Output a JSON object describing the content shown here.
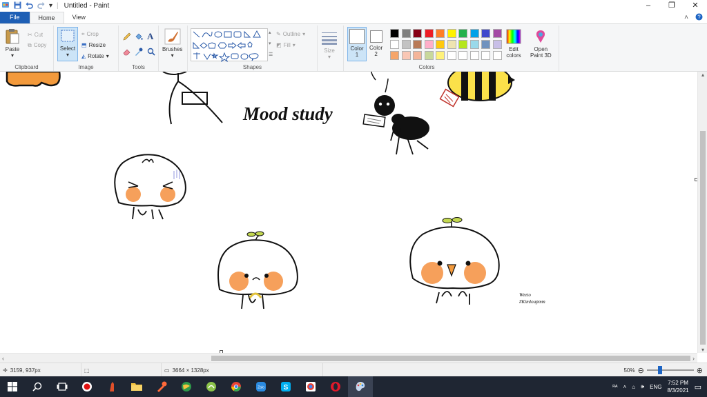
{
  "window": {
    "title": "Untitled - Paint"
  },
  "tabs": [
    {
      "label": "File"
    },
    {
      "label": "Home"
    },
    {
      "label": "View"
    }
  ],
  "ribbon": {
    "clipboard": {
      "label": "Clipboard",
      "paste": "Paste",
      "cut": "Cut",
      "copy": "Copy"
    },
    "image": {
      "label": "Image",
      "select": "Select",
      "crop": "Crop",
      "resize": "Resize",
      "rotate": "Rotate"
    },
    "tools": {
      "label": "Tools"
    },
    "brushes": {
      "label": "Brushes"
    },
    "shapes": {
      "label": "Shapes",
      "outline": "Outline",
      "fill": "Fill"
    },
    "size": {
      "label": "Size"
    },
    "colors": {
      "label": "Colors",
      "color1": "Color",
      "color1_num": "1",
      "color2": "Color",
      "color2_num": "2",
      "edit_colors_1": "Edit",
      "edit_colors_2": "colors",
      "paint3d_1": "Open",
      "paint3d_2": "Paint 3D",
      "palette_row1": [
        "#000000",
        "#7f7f7f",
        "#880015",
        "#ed1c24",
        "#ff7f27",
        "#fff200",
        "#22b14c",
        "#00a2e8",
        "#3f48cc",
        "#a349a4"
      ],
      "palette_row2": [
        "#ffffff",
        "#c3c3c3",
        "#b97a57",
        "#ffaec9",
        "#ffc90e",
        "#efe4b0",
        "#b5e61d",
        "#99d9ea",
        "#7092be",
        "#c8bfe7"
      ],
      "palette_row3": [
        "#f5a56a",
        "#f9c7b5",
        "#f4b59a",
        "#c8d89c",
        "#fff27a",
        "#ffffff",
        "#ffffff",
        "#ffffff",
        "#ffffff",
        "#ffffff"
      ]
    }
  },
  "canvas": {
    "handwritten_text": "Mood study",
    "signature_line1": "Weeto",
    "signature_line2": "#Kimloupmm"
  },
  "status": {
    "cursor_pos": "3159, 937px",
    "image_size": "3664 × 1328px",
    "zoom": "50%"
  },
  "taskbar": {
    "lang": "ENG",
    "time": "7:52 PM",
    "date": "8/3/2021"
  }
}
